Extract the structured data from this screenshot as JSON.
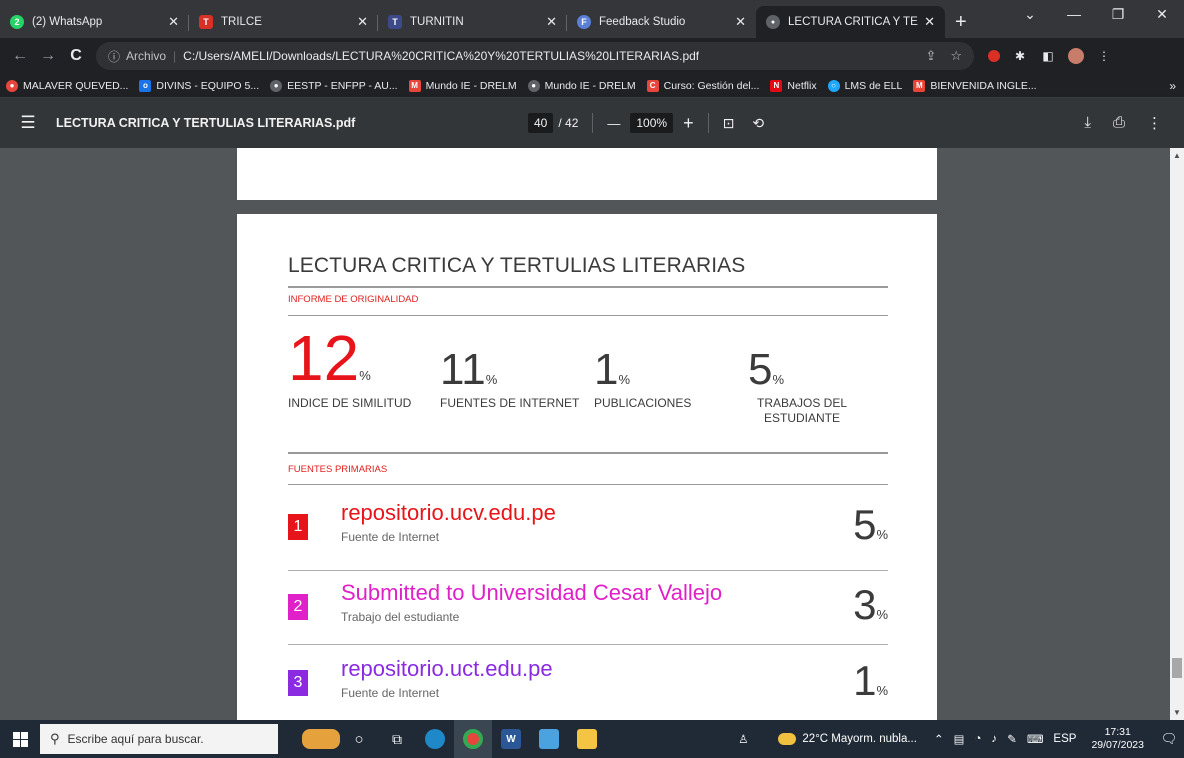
{
  "tabs": [
    {
      "title": "(2) WhatsApp",
      "icon": "whatsapp-icon",
      "color": "#25d366",
      "glyph": "2"
    },
    {
      "title": "TRILCE",
      "icon": "trilce-icon",
      "color": "#d93025",
      "glyph": "T"
    },
    {
      "title": "TURNITIN",
      "icon": "turnitin-icon",
      "color": "#3c4a8a",
      "glyph": "T"
    },
    {
      "title": "Feedback Studio",
      "icon": "feedback-studio-icon",
      "color": "#5a7fd6",
      "glyph": "F"
    },
    {
      "title": "LECTURA CRITICA Y TERTULI",
      "icon": "globe-icon",
      "color": "#5f6368",
      "glyph": "●"
    }
  ],
  "tab_close": "✕",
  "new_tab": "+",
  "window_controls": {
    "dropdown": "⌄",
    "minimize": "—",
    "maximize": "❐",
    "close": "✕"
  },
  "address": {
    "info": "ⓘ",
    "protocol": "Archivo",
    "separator": "|",
    "url": "C:/Users/AMELI/Downloads/LECTURA%20CRITICA%20Y%20TERTULIAS%20LITERARIAS.pdf"
  },
  "bookmarks": [
    {
      "label": "MALAVER QUEVED...",
      "color": "#e8453c",
      "glyph": "●"
    },
    {
      "label": "DIVINS - EQUIPO 5...",
      "color": "#1a73e8",
      "glyph": "o"
    },
    {
      "label": "EESTP - ENFPP - AU...",
      "color": "#5f6368",
      "glyph": "●"
    },
    {
      "label": "Mundo IE - DRELM",
      "color": "#e8453c",
      "glyph": "M"
    },
    {
      "label": "Mundo IE - DRELM",
      "color": "#5f6368",
      "glyph": "●"
    },
    {
      "label": "Curso: Gestión del...",
      "color": "#e8453c",
      "glyph": "C"
    },
    {
      "label": "Netflix",
      "color": "#e50914",
      "glyph": "N"
    },
    {
      "label": "LMS de ELL",
      "color": "#1ea7fd",
      "glyph": "○"
    },
    {
      "label": "BIENVENIDA INGLE...",
      "color": "#ea4335",
      "glyph": "M"
    }
  ],
  "bookmarks_more": "»",
  "pdf": {
    "title": "LECTURA CRITICA Y TERTULIAS LITERARIAS.pdf",
    "page": "40",
    "total": "/ 42",
    "zoom": "100%",
    "minus": "—",
    "plus": "+"
  },
  "report": {
    "title": "LECTURA CRITICA Y TERTULIAS LITERARIAS",
    "section_originality": "INFORME DE ORIGINALIDAD",
    "stats": [
      {
        "value": "12",
        "pct": "%",
        "label": "INDICE DE SIMILITUD"
      },
      {
        "value": "11",
        "pct": "%",
        "label": "FUENTES DE INTERNET"
      },
      {
        "value": "1",
        "pct": "%",
        "label": "PUBLICACIONES"
      },
      {
        "value": "5",
        "pct": "%",
        "label": "TRABAJOS DEL ESTUDIANTE"
      }
    ],
    "section_sources": "FUENTES PRIMARIAS",
    "sources": [
      {
        "num": "1",
        "name": "repositorio.ucv.edu.pe",
        "type": "Fuente de Internet",
        "value": "5",
        "pct": "%",
        "color": "#e8141b"
      },
      {
        "num": "2",
        "name": "Submitted to Universidad Cesar Vallejo",
        "type": "Trabajo del estudiante",
        "value": "3",
        "pct": "%",
        "color": "#e020c8"
      },
      {
        "num": "3",
        "name": "repositorio.uct.edu.pe",
        "type": "Fuente de Internet",
        "value": "1",
        "pct": "%",
        "color": "#8a2be2"
      }
    ]
  },
  "taskbar": {
    "search_placeholder": "Escribe aquí para buscar.",
    "weather": "22°C  Mayorm. nubla...",
    "language": "ESP",
    "time": "17:31",
    "date": "29/07/2023"
  }
}
